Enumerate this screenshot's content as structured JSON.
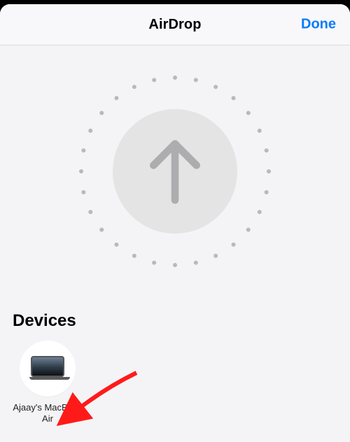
{
  "sheet": {
    "title": "AirDrop",
    "done_label": "Done"
  },
  "icons": {
    "radar_arrow": "arrow-up-icon",
    "annotation": "red-arrow-icon"
  },
  "devices_header": "Devices",
  "devices": {
    "items": [
      {
        "label": "Ajaay's MacBook Air",
        "icon": "macbook-icon"
      }
    ]
  },
  "colors": {
    "accent": "#0a7aff",
    "annotation": "#ff1a1a"
  }
}
